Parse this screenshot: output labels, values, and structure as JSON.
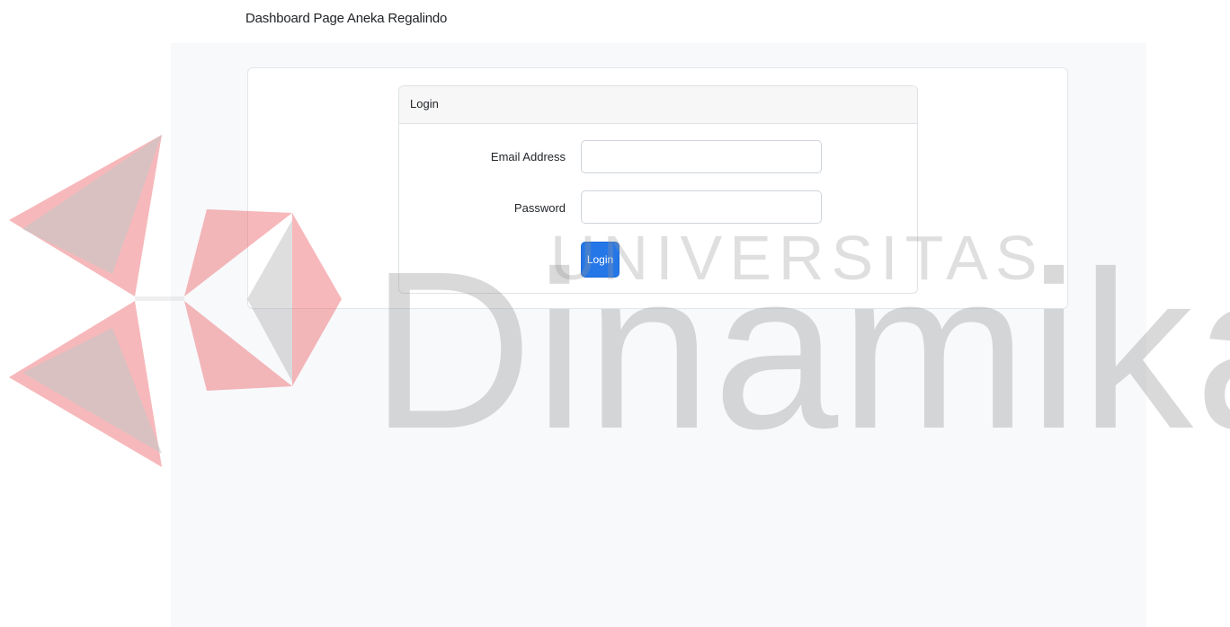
{
  "navbar": {
    "brand": "Dashboard Page Aneka Regalindo"
  },
  "login_card": {
    "header": "Login",
    "email_label": "Email Address",
    "email_value": "",
    "password_label": "Password",
    "password_value": "",
    "submit_label": "Login"
  },
  "watermark": {
    "line1": "UNIVERSITAS",
    "line2": "Dinamika"
  },
  "colors": {
    "primary_button": "#2577e8",
    "page_background": "#f8f9fb",
    "watermark_red": "#e8474d",
    "watermark_gray": "#8c8c8c"
  }
}
